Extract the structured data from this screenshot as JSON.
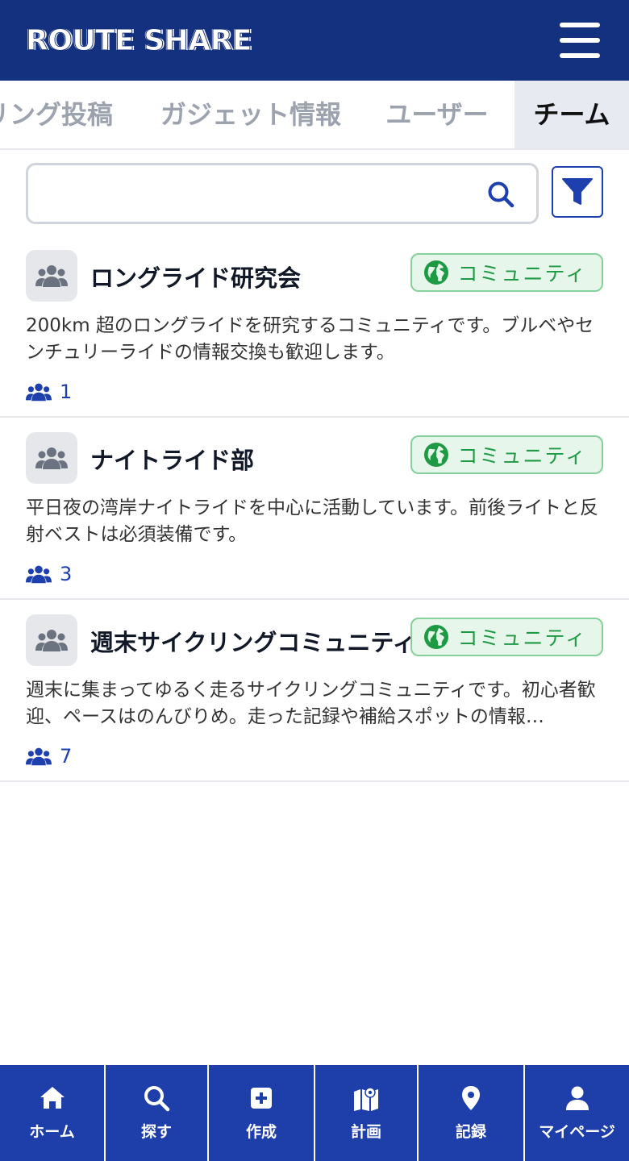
{
  "header": {
    "logo": "ROUTE SHARE"
  },
  "tabs": [
    {
      "label": "リング投稿"
    },
    {
      "label": "ガジェット情報"
    },
    {
      "label": "ユーザー"
    },
    {
      "label": "チーム",
      "active": true
    }
  ],
  "search": {
    "value": "",
    "placeholder": ""
  },
  "teams": [
    {
      "name": "ロングライド研究会",
      "badge": "コミュニティ",
      "description": "200km 超のロングライドを研究するコミュニティです。ブルベやセンチュリーライドの情報交換も歓迎します。",
      "members": "1"
    },
    {
      "name": "ナイトライド部",
      "badge": "コミュニティ",
      "description": "平日夜の湾岸ナイトライドを中心に活動しています。前後ライトと反射ベストは必須装備です。",
      "members": "3"
    },
    {
      "name": "週末サイクリングコミュニティ",
      "badge": "コミュニティ",
      "description": "週末に集まってゆるく走るサイクリングコミュニティです。初心者歓迎、ペースはのんびりめ。走った記録や補給スポットの情報…",
      "members": "7"
    }
  ],
  "bottom_nav": [
    {
      "label": "ホーム",
      "icon": "home-icon"
    },
    {
      "label": "探す",
      "icon": "search-icon"
    },
    {
      "label": "作成",
      "icon": "plus-square-icon"
    },
    {
      "label": "計画",
      "icon": "map-icon"
    },
    {
      "label": "記録",
      "icon": "map-pin-icon"
    },
    {
      "label": "マイページ",
      "icon": "user-icon"
    }
  ],
  "colors": {
    "header": "#14317f",
    "nav": "#1e3faa",
    "accent": "#1e40af",
    "badge_green": "#1f9a44"
  }
}
